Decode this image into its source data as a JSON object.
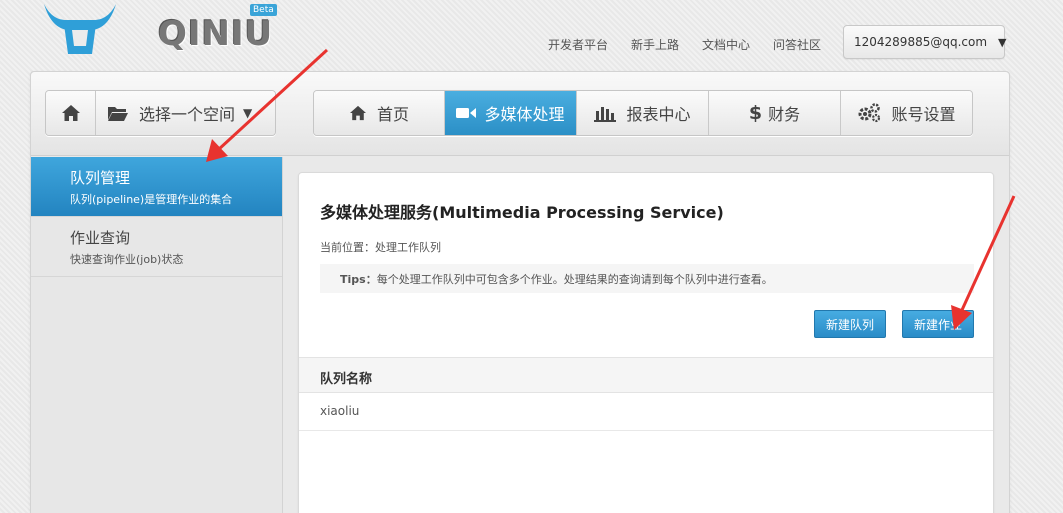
{
  "brand": {
    "name": "QINIU",
    "badge": "Beta"
  },
  "top_links": [
    "开发者平台",
    "新手上路",
    "文档中心",
    "问答社区"
  ],
  "user": {
    "email": "1204289885@qq.com"
  },
  "space_selector": {
    "label": "选择一个空间"
  },
  "nav": {
    "home": "首页",
    "media": "多媒体处理",
    "reports": "报表中心",
    "finance": "财务",
    "account": "账号设置"
  },
  "sidebar": {
    "items": [
      {
        "title": "队列管理",
        "subtitle": "队列(pipeline)是管理作业的集合",
        "active": true
      },
      {
        "title": "作业查询",
        "subtitle": "快速查询作业(job)状态",
        "active": false
      }
    ]
  },
  "content": {
    "title": "多媒体处理服务(Multimedia Processing Service)",
    "breadcrumb_label": "当前位置：",
    "breadcrumb_value": "处理工作队列",
    "tips_label": "Tips：",
    "tips_text": "每个处理工作队列中可包含多个作业。处理结果的查询请到每个队列中进行查看。",
    "new_queue": "新建队列",
    "new_job": "新建作业",
    "table_header": "队列名称",
    "rows": [
      "xiaoliu"
    ]
  },
  "colors": {
    "accent": "#2b8fc6",
    "annotation": "#e8332f"
  }
}
